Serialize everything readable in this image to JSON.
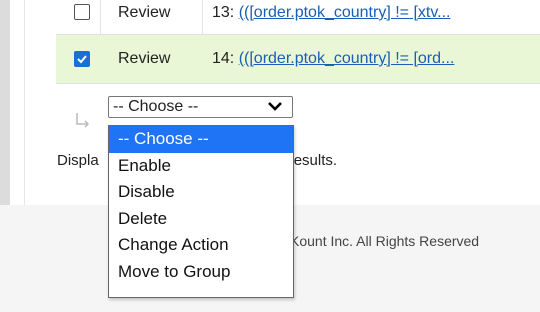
{
  "colors": {
    "selected_bg": "#1e74f5",
    "checked_row_bg": "#eaf7d7",
    "link": "#1a5fb4",
    "checkbox": "#1a6fd6"
  },
  "rows": [
    {
      "checked": false,
      "action": "Review",
      "desc_prefix": "13: ",
      "desc_link": "(([order.ptok_country] != [xtv..."
    },
    {
      "checked": true,
      "action": "Review",
      "desc_prefix": "14: ",
      "desc_link": "(([order.ptok_country] != [ord..."
    }
  ],
  "bulk": {
    "icon": "corner-arrow-icon",
    "select_value": "-- Choose --"
  },
  "footer": {
    "results_text_left": "Displa",
    "results_text_right": "tal results.",
    "copyright": "Kount Inc. All Rights Reserved"
  },
  "dropdown": {
    "options": [
      "-- Choose --",
      "Enable",
      "Disable",
      "Delete",
      "Change Action",
      "Move to Group"
    ],
    "selected_index": 0
  }
}
